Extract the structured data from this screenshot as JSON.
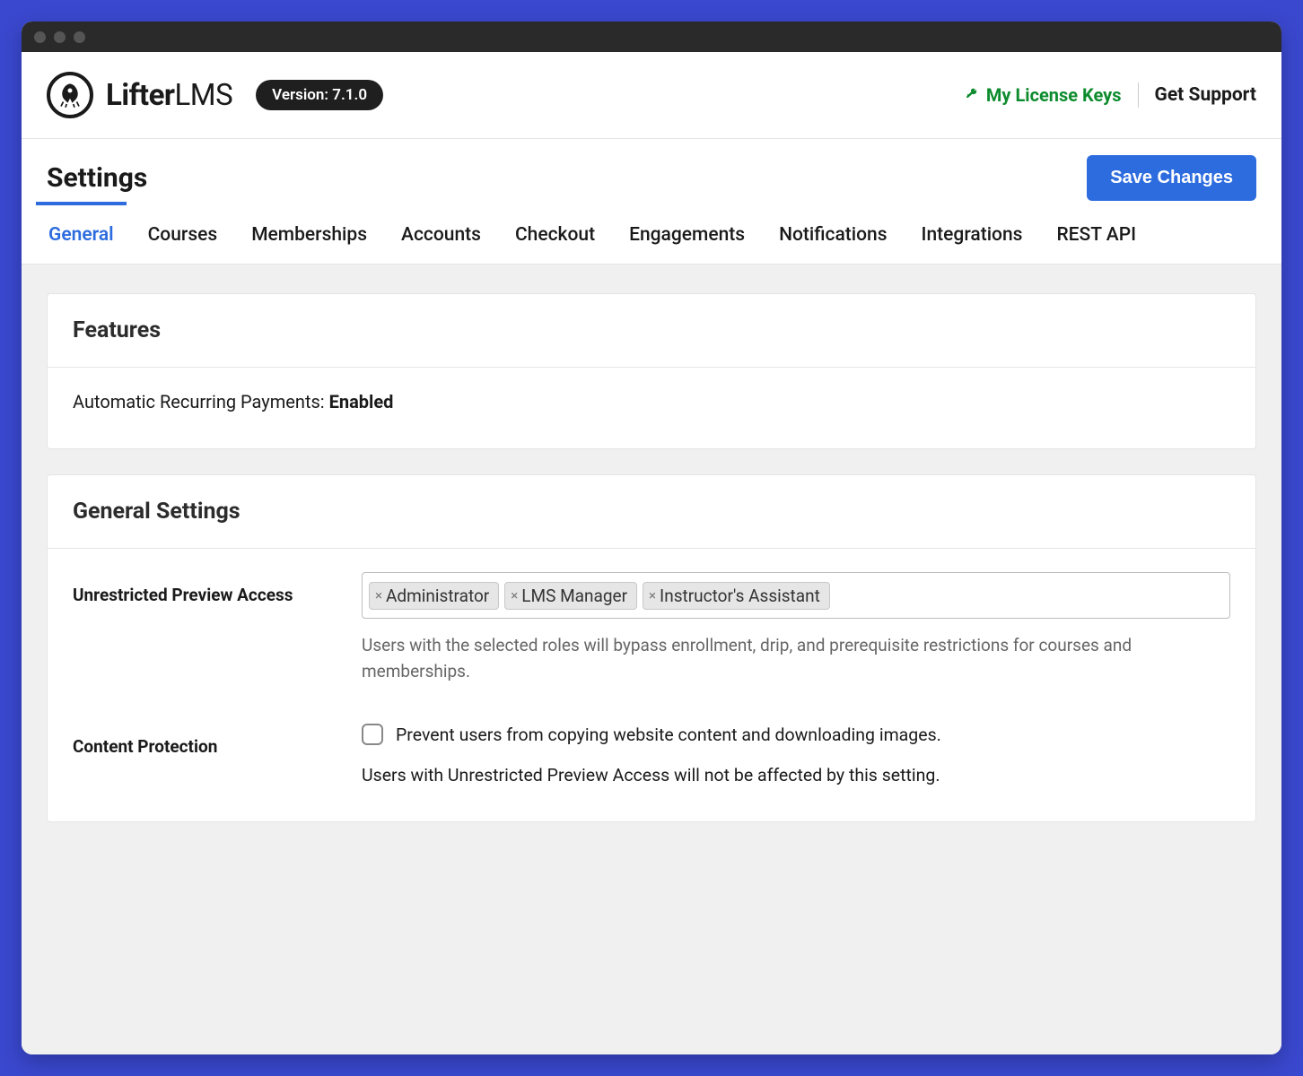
{
  "brand": {
    "name_bold": "Lifter",
    "name_light": "LMS"
  },
  "version_badge": "Version: 7.1.0",
  "header": {
    "license": "My License Keys",
    "support": "Get Support"
  },
  "page_title": "Settings",
  "save_button": "Save Changes",
  "tabs": [
    "General",
    "Courses",
    "Memberships",
    "Accounts",
    "Checkout",
    "Engagements",
    "Notifications",
    "Integrations",
    "REST API"
  ],
  "features_card": {
    "title": "Features",
    "row_label": "Automatic Recurring Payments: ",
    "row_value": "Enabled"
  },
  "general_card": {
    "title": "General Settings",
    "preview": {
      "label": "Unrestricted Preview Access",
      "tags": [
        "Administrator",
        "LMS Manager",
        "Instructor's Assistant"
      ],
      "help": "Users with the selected roles will bypass enrollment, drip, and prerequisite restrictions for courses and memberships."
    },
    "content_protection": {
      "label": "Content Protection",
      "checkbox_text": "Prevent users from copying website content and downloading images.",
      "note": "Users with Unrestricted Preview Access will not be affected by this setting."
    }
  }
}
